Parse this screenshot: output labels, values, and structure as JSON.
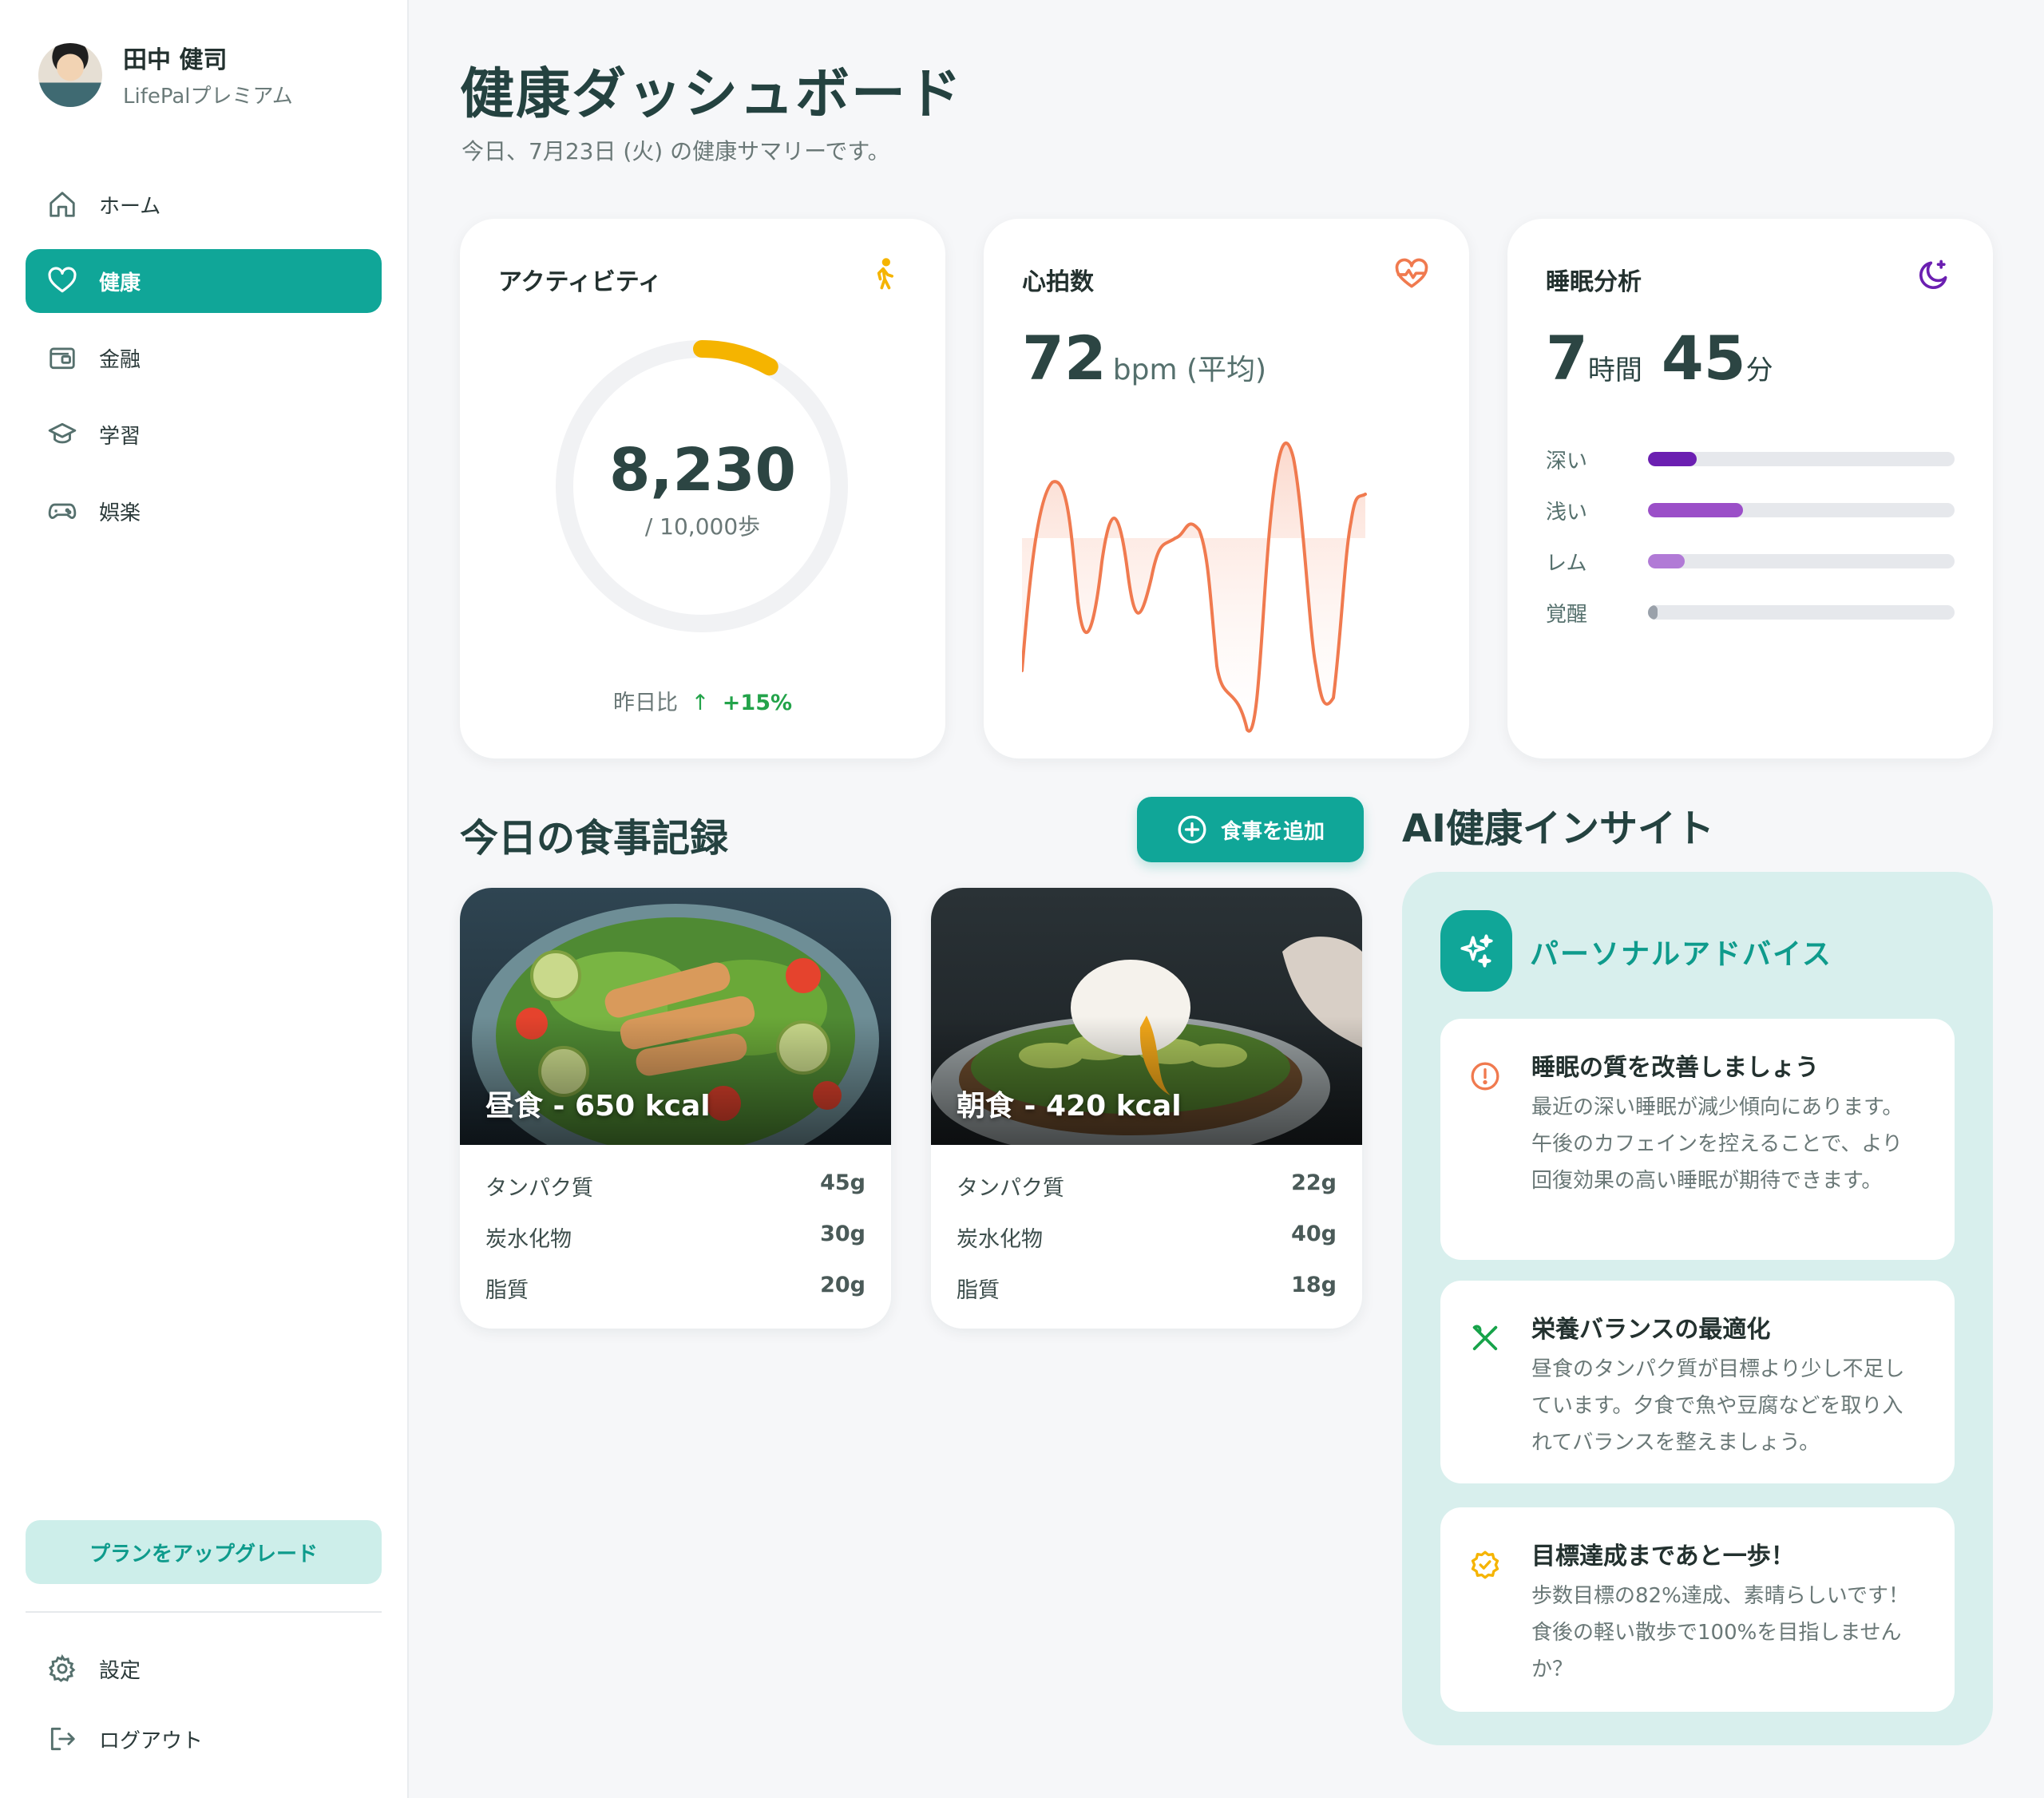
{
  "user": {
    "name": "田中 健司",
    "plan": "LifePalプレミアム"
  },
  "nav": {
    "items": [
      {
        "label": "ホーム",
        "icon": "home-icon"
      },
      {
        "label": "健康",
        "icon": "heart-icon",
        "active": true
      },
      {
        "label": "金融",
        "icon": "wallet-icon"
      },
      {
        "label": "学習",
        "icon": "graduation-cap-icon"
      },
      {
        "label": "娯楽",
        "icon": "gamepad-icon"
      }
    ],
    "upgrade_label": "プランをアップグレード",
    "settings_label": "設定",
    "logout_label": "ログアウト"
  },
  "page": {
    "title": "健康ダッシュボード",
    "subtitle": "今日、7月23日 (火) の健康サマリーです。"
  },
  "activity": {
    "title": "アクティビティ",
    "steps": "8,230",
    "goal": "/ 10,000歩",
    "progress_fraction": 0.082,
    "compare_label": "昨日比",
    "compare_value": "+15%",
    "accent": "#f5b400"
  },
  "heart_rate": {
    "title": "心拍数",
    "value": "72",
    "unit": "bpm (平均)",
    "accent": "#f07a4f"
  },
  "sleep": {
    "title": "睡眠分析",
    "hours": "7",
    "hours_unit": "時間",
    "minutes": "45",
    "minutes_unit": "分",
    "stages": [
      {
        "label": "深い",
        "fraction": 0.16,
        "color": "#6b1fb1"
      },
      {
        "label": "浅い",
        "fraction": 0.31,
        "color": "#9b4fc8"
      },
      {
        "label": "レム",
        "fraction": 0.12,
        "color": "#b17ad6"
      },
      {
        "label": "覚醒",
        "fraction": 0.03,
        "color": "#9aa1aa"
      }
    ]
  },
  "meals": {
    "title": "今日の食事記録",
    "add_label": "食事を追加",
    "items": [
      {
        "caption": "昼食 - 650 kcal",
        "macros": [
          {
            "name": "タンパク質",
            "value": "45g"
          },
          {
            "name": "炭水化物",
            "value": "30g"
          },
          {
            "name": "脂質",
            "value": "20g"
          }
        ]
      },
      {
        "caption": "朝食 - 420 kcal",
        "macros": [
          {
            "name": "タンパク質",
            "value": "22g"
          },
          {
            "name": "炭水化物",
            "value": "40g"
          },
          {
            "name": "脂質",
            "value": "18g"
          }
        ]
      }
    ]
  },
  "ai": {
    "section_title": "AI健康インサイト",
    "header": "パーソナルアドバイス",
    "tips": [
      {
        "icon": "alert-circle-icon",
        "title": "睡眠の質を改善しましょう",
        "body": "最近の深い睡眠が減少傾向にあります。午後のカフェインを控えることで、より回復効果の高い睡眠が期待できます。"
      },
      {
        "icon": "utensils-icon",
        "title": "栄養バランスの最適化",
        "body": "昼食のタンパク質が目標より少し不足しています。夕食で魚や豆腐などを取り入れてバランスを整えましょう。"
      },
      {
        "icon": "badge-check-icon",
        "title": "目標達成まであと一歩！",
        "body": "歩数目標の82%達成、素晴らしいです！食後の軽い散歩で100%を目指しませんか？"
      }
    ]
  },
  "colors": {
    "primary": "#10a698",
    "sidebar_active": "#10a698"
  }
}
